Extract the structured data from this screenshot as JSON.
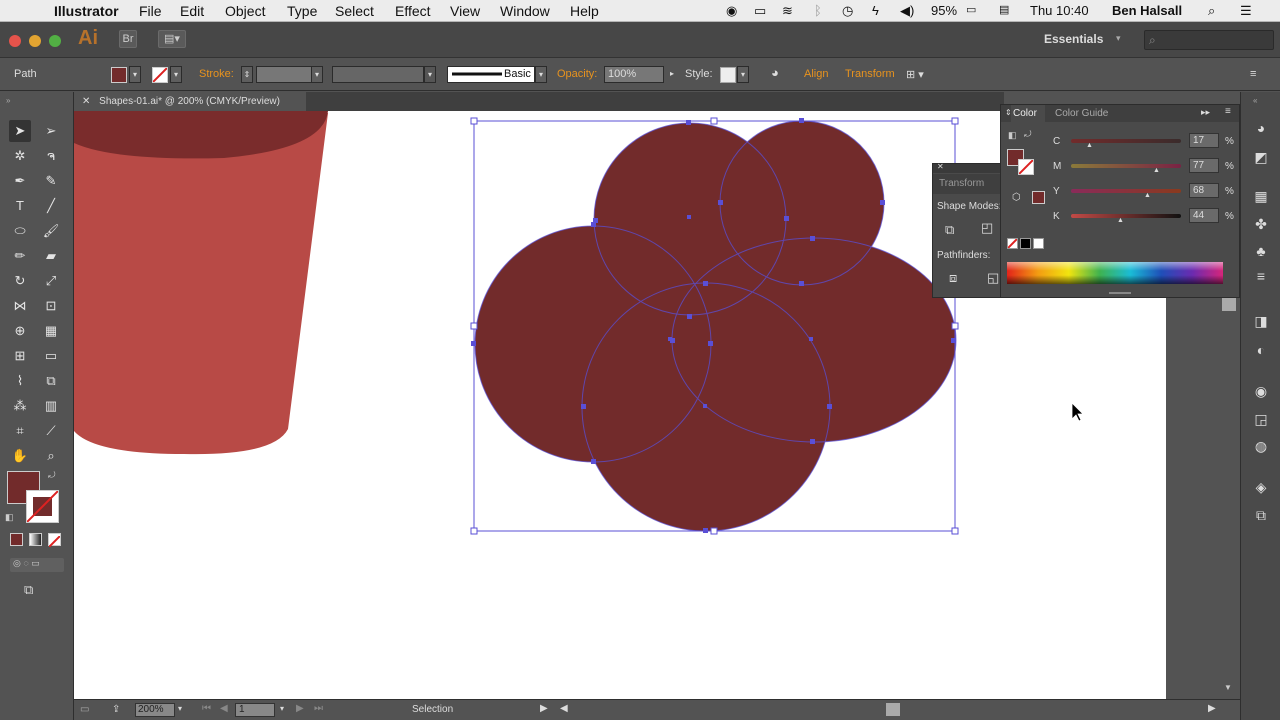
{
  "menubar": {
    "app_name": "Illustrator",
    "items": [
      "File",
      "Edit",
      "Object",
      "Type",
      "Select",
      "Effect",
      "View",
      "Window",
      "Help"
    ],
    "battery": "95%",
    "clock": "Thu 10:40",
    "user": "Ben Halsall"
  },
  "appbar": {
    "logo": "Ai",
    "workspace": "Essentials"
  },
  "controlbar": {
    "selection_type": "Path",
    "stroke_label": "Stroke:",
    "brush_label": "Basic",
    "opacity_label": "Opacity:",
    "opacity_value": "100%",
    "style_label": "Style:",
    "align_label": "Align",
    "transform_label": "Transform",
    "fill_color": "#722b2b"
  },
  "document": {
    "tab_title": "Shapes-01.ai* @ 200% (CMYK/Preview)"
  },
  "statusbar": {
    "zoom": "200%",
    "artboard": "1",
    "current_tool": "Selection"
  },
  "color_panel": {
    "tab_color": "Color",
    "tab_guide": "Color Guide",
    "channels": [
      {
        "label": "C",
        "value": "17",
        "pct": "%",
        "pos": 0.17
      },
      {
        "label": "M",
        "value": "77",
        "pct": "%",
        "pos": 0.77
      },
      {
        "label": "Y",
        "value": "68",
        "pct": "%",
        "pos": 0.68
      },
      {
        "label": "K",
        "value": "44",
        "pct": "%",
        "pos": 0.44
      }
    ]
  },
  "transform_panel": {
    "title": "Transform",
    "shape_modes": "Shape Modes:",
    "pathfinders": "Pathfinders:"
  },
  "colors": {
    "fill": "#722b2b",
    "cup": "#b84a46",
    "cup_top": "#7a2c2c",
    "selection": "#5a4fd6",
    "accent_orange": "#e8931e"
  }
}
